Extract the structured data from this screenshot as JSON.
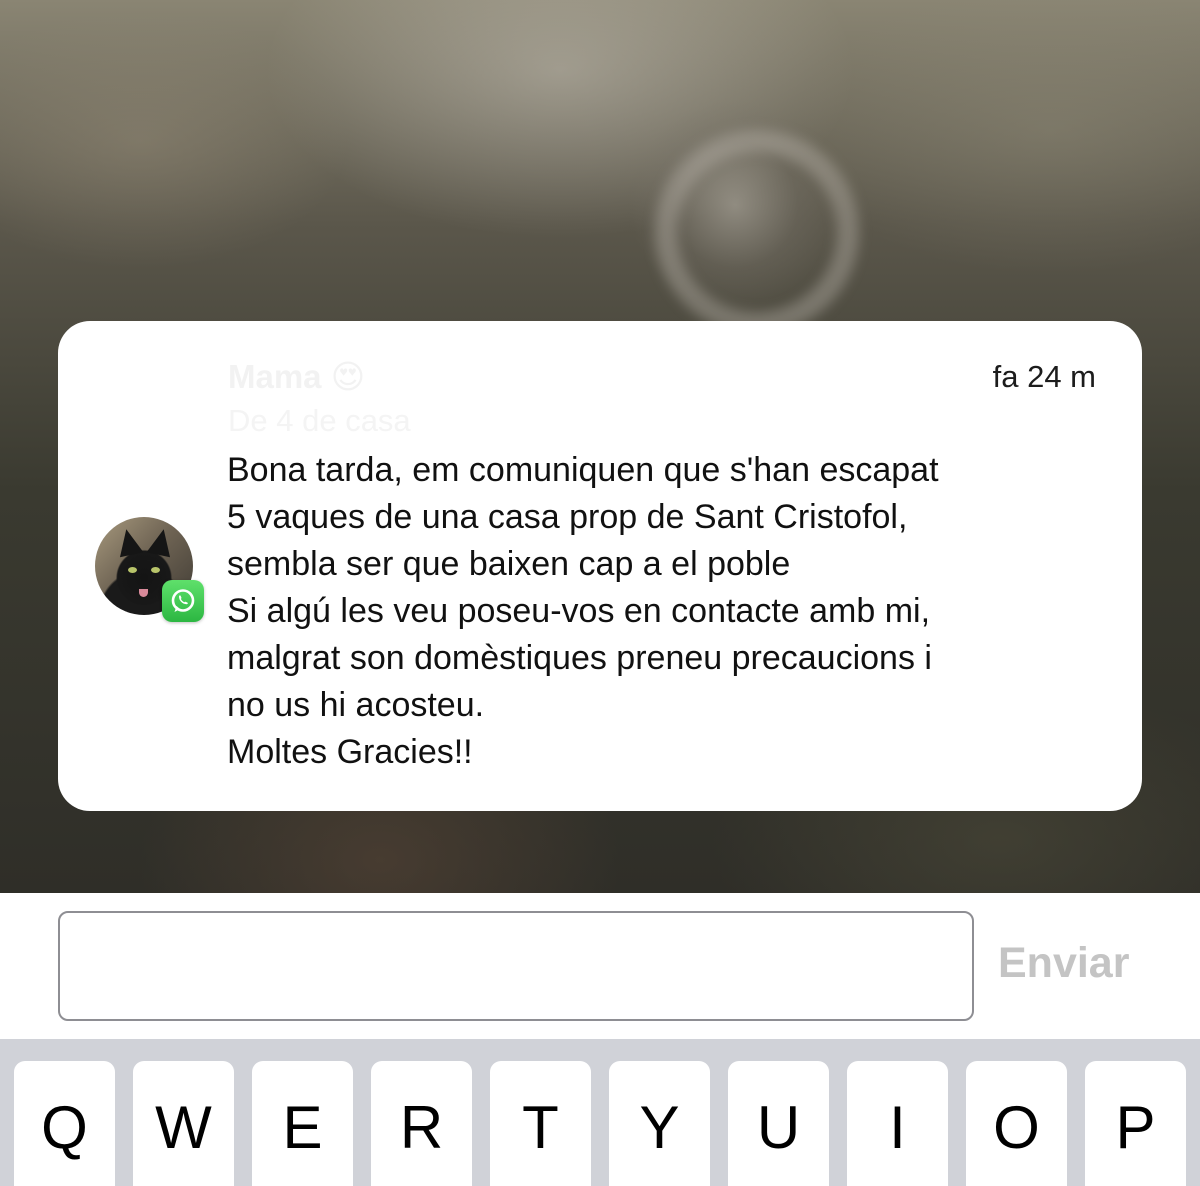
{
  "notification": {
    "sender_name": "Mama 😍",
    "sender_subtitle": "De 4 de casa",
    "timestamp": "fa 24 m",
    "message": "Bona tarda, em comuniquen que s'han escapat\n5 vaques de una casa prop de Sant Cristofol,\nsembla ser que baixen cap a el poble\nSi algú les veu poseu-vos en contacte amb mi,\nmalgrat son domèstiques preneu precaucions i\nno us hi acosteu.\nMoltes Gracies!!",
    "app_icon": "whatsapp-icon",
    "avatar": "black-cat-photo"
  },
  "composer": {
    "input_value": "",
    "send_label": "Enviar"
  },
  "keyboard": {
    "row1": [
      "Q",
      "W",
      "E",
      "R",
      "T",
      "Y",
      "U",
      "I",
      "O",
      "P"
    ]
  },
  "colors": {
    "send_disabled": "#c4c4c4",
    "keyboard_bg": "#d0d2d8",
    "whatsapp_green": "#2cb742"
  }
}
